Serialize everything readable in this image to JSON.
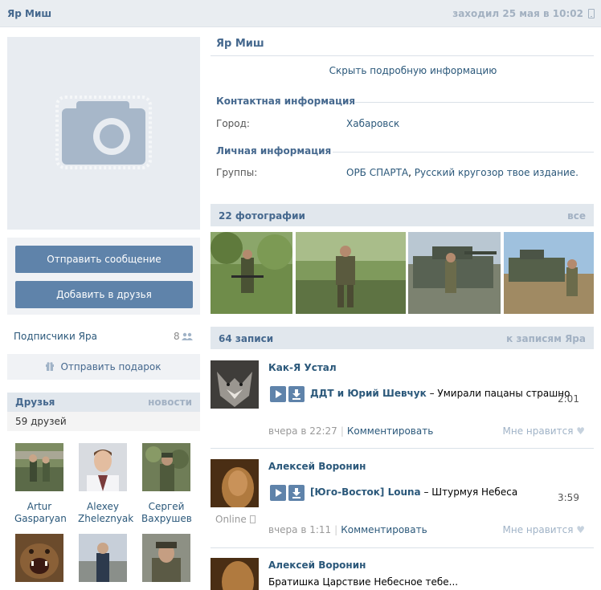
{
  "header": {
    "name": "Яр Миш",
    "last_seen": "заходил 25 мая в 10:02"
  },
  "profile": {
    "name": "Яр Миш",
    "hide_info": "Скрыть подробную информацию",
    "contact_title": "Контактная информация",
    "city_label": "Город:",
    "city_value": "Хабаровск",
    "personal_title": "Личная информация",
    "groups_label": "Группы:",
    "group1": "ОРБ СПАРТА",
    "group_sep": ", ",
    "group2": "Русский кругозор твое издание."
  },
  "actions": {
    "send_message": "Отправить сообщение",
    "add_friend": "Добавить в друзья",
    "send_gift": "Отправить подарок"
  },
  "subscribers": {
    "label": "Подписчики Яра",
    "count": "8"
  },
  "friends": {
    "title": "Друзья",
    "news": "новости",
    "count": "59 друзей",
    "list": [
      {
        "first": "Artur",
        "last": "Gasparyan"
      },
      {
        "first": "Alexey",
        "last": "Zheleznyak"
      },
      {
        "first": "Сергей",
        "last": "Вахрушев"
      },
      {
        "first": "",
        "last": ""
      },
      {
        "first": "",
        "last": ""
      },
      {
        "first": "",
        "last": ""
      }
    ]
  },
  "photos": {
    "title": "22 фотографии",
    "all": "все"
  },
  "wall": {
    "title": "64 записи",
    "link": "к записям Яра",
    "posts": [
      {
        "author": "Как-Я Устал",
        "artist": "ДДТ и Юрий Шевчук",
        "dash": " – ",
        "track": "Умирали пацаны страшно",
        "duration": "2:01",
        "time": "вчера в 22:27",
        "sep": "|",
        "comment": "Комментировать",
        "like": "Мне нравится"
      },
      {
        "author": "Алексей Воронин",
        "artist": "[Юго-Восток] Louna",
        "dash": " – ",
        "track": "Штурмуя Небеса",
        "duration": "3:59",
        "time": "вчера в 1:11",
        "sep": "|",
        "comment": "Комментировать",
        "like": "Мне нравится",
        "status": "Online"
      },
      {
        "author": "Алексей Воронин",
        "text": "Братишка Царствие Небесное тебе..."
      }
    ]
  },
  "colors": {
    "accent": "#5f83aa",
    "link": "#2b587a",
    "header_bg": "#e1e7ed"
  }
}
